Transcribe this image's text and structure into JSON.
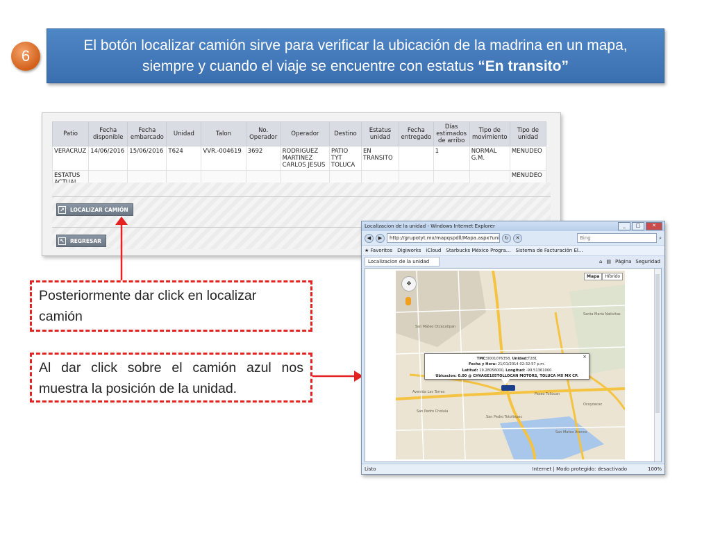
{
  "slide": {
    "step_number": "6",
    "header_text": "El botón localizar camión sirve para verificar la ubicación de la madrina en un mapa, siempre y cuando el viaje se encuentre con estatus ",
    "header_bold": "“En transito”",
    "colors": {
      "banner": "#3f78b9",
      "badge": "#e07a36",
      "note_border": "#e32222",
      "arrow": "#e32222",
      "truck": "#1c3f8c"
    }
  },
  "table": {
    "headers": [
      "Patio",
      "Fecha disponible",
      "Fecha embarcado",
      "Unidad",
      "Talon",
      "No. Operador",
      "Operador",
      "Destino",
      "Estatus unidad",
      "Fecha entregado",
      "Días estimados de arribo",
      "Tipo de movimiento",
      "Tipo de unidad"
    ],
    "row": {
      "patio": "VERACRUZ",
      "fecha_disponible": "14/06/2016",
      "fecha_embarcado": "15/06/2016",
      "unidad": "T624",
      "talon": "VVR.-004619",
      "no_operador": "3692",
      "operador": "RODRIGUEZ MARTINEZ CARLOS JESUS",
      "destino": "PATIO TYT TOLUCA",
      "estatus": "EN TRANSITO",
      "fecha_entregado": "",
      "dias": "1",
      "tipo_movimiento": "NORMAL G.M.",
      "tipo_unidad": "MENUDEO"
    },
    "status_row": {
      "label": "ESTATUS ACTUAL",
      "tipo_unidad": "MENUDEO"
    }
  },
  "buttons": {
    "localizar": "LOCALIZAR CAMIÓN",
    "regresar": "REGRESAR"
  },
  "notes": {
    "note1": "Posteriormente dar click en localizar camión",
    "note2": "Al dar click sobre el camión azul nos muestra la posición de la unidad."
  },
  "browser": {
    "title": "Localizacion de la unidad - Windows Internet Explorer",
    "url": "http://grupotyt.mx/mapqspdll/Mapa.aspx?unitnum",
    "search_placeholder": "Bing",
    "favorites": [
      "Favoritos",
      "Digiworks",
      "iCloud",
      "Starbucks México Progra...",
      "Sistema de Facturación El..."
    ],
    "tab": "Localizacion de la unidad",
    "commands": [
      "Página",
      "Seguridad"
    ],
    "status_left": "Listo",
    "status_mid": "Internet | Modo protegido: desactivado",
    "zoom": "100%"
  },
  "map": {
    "types": [
      "Mapa",
      "Híbrido"
    ],
    "info": {
      "line1_label": "TMC:",
      "line1_value": "0001076358,",
      "unit_label": "Unidad:",
      "unit_value": "T281",
      "line2_label": "Fecha y Hora:",
      "line2_value": "21/01/2014 02:32:57 p.m.",
      "lat_label": "Latitud:",
      "lat_value": "19.28056000,",
      "lon_label": "Longitud:",
      "lon_value": "-99.51361000",
      "loc_label": "Ubicacion: ",
      "loc_value": "0.00 @ CHVAGE105TOLLOCAN MOTORS, TOLUCA MX MX CP."
    },
    "labels": [
      "Avenida Las Torres",
      "Paseo Tollocan",
      "San Pedro Totoltepec",
      "San Mateo Otzacatipan",
      "San Pedro Cholula",
      "Ocoyoacac",
      "San Mateo Atenco",
      "Santa Maria Nativitas"
    ]
  }
}
